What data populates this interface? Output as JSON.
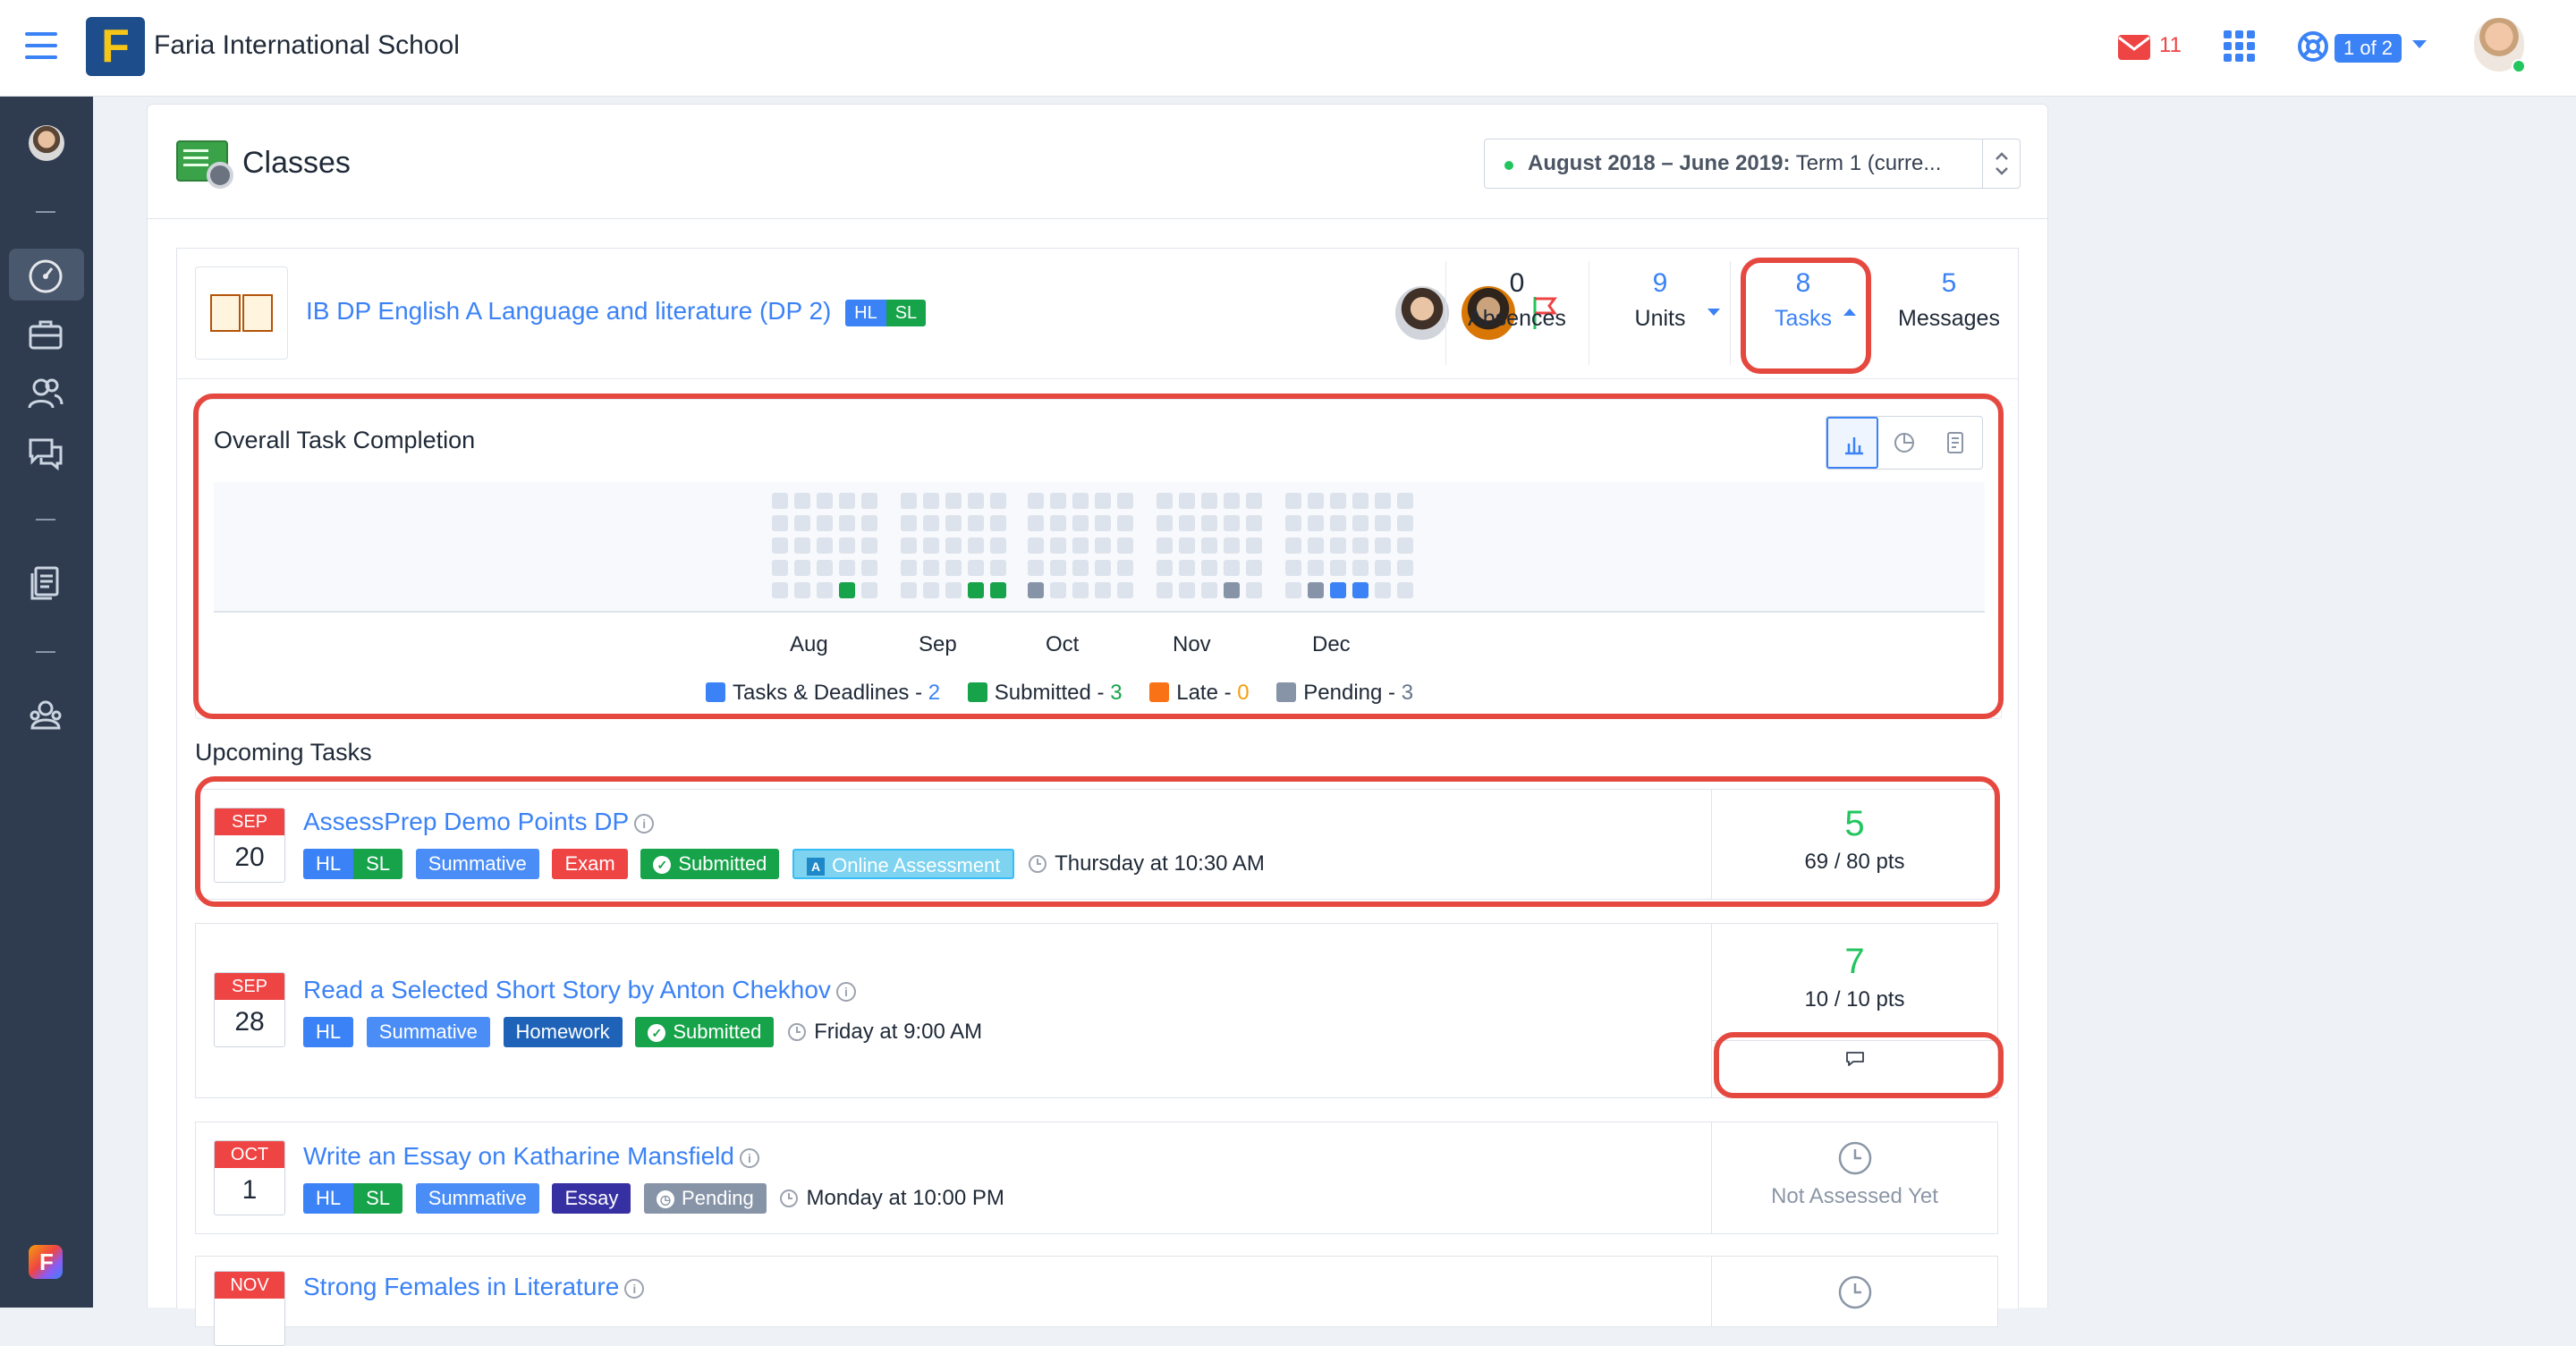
{
  "app": {
    "school_name": "Faria International School",
    "logo_letter": "F",
    "mail_count": "11",
    "pager_label": "1 of 2",
    "accent_color": "#3b82f6"
  },
  "sidebar": {
    "items": [
      {
        "name": "avatar"
      },
      {
        "name": "dashboard-icon",
        "active": true
      },
      {
        "name": "briefcase-icon"
      },
      {
        "name": "users-icon"
      },
      {
        "name": "chat-icon"
      },
      {
        "name": "documents-icon"
      },
      {
        "name": "settings-people-icon"
      }
    ]
  },
  "classes": {
    "title": "Classes",
    "term_bold": "August 2018 – June 2019:",
    "term_rest": " Term 1 (curre..."
  },
  "class": {
    "name": "IB DP English A Language and literature (DP 2)",
    "levels": [
      "HL",
      "SL"
    ],
    "stats": [
      {
        "num": "0",
        "label": "Absences"
      },
      {
        "num": "9",
        "label": "Units"
      },
      {
        "num": "8",
        "label": "Tasks"
      },
      {
        "num": "5",
        "label": "Messages"
      }
    ]
  },
  "completion": {
    "title": "Overall Task Completion",
    "months": [
      "Aug",
      "Sep",
      "Oct",
      "Nov",
      "Dec"
    ],
    "legend": [
      {
        "label": "Tasks & Deadlines",
        "sep": " - ",
        "value": "2",
        "color": "#3b82f6"
      },
      {
        "label": "Submitted",
        "sep": " - ",
        "value": "3",
        "color": "#16a34a"
      },
      {
        "label": "Late",
        "sep": " - ",
        "value": "0",
        "color": "#f59e0b"
      },
      {
        "label": "Pending",
        "sep": " - ",
        "value": "3",
        "color": "#8794a8"
      }
    ]
  },
  "upcoming": {
    "title": "Upcoming Tasks",
    "tasks": [
      {
        "month": "SEP",
        "day": "20",
        "title": "AssessPrep Demo Points DP",
        "tags": [
          "HL",
          "SL",
          "Summative",
          "Exam",
          "Submitted",
          "Online Assessment"
        ],
        "when": "Thursday at 10:30 AM",
        "score": "5",
        "pts": "69 / 80 pts"
      },
      {
        "month": "SEP",
        "day": "28",
        "title": "Read a Selected Short Story by Anton Chekhov",
        "tags": [
          "HL",
          "Summative",
          "Homework",
          "Submitted"
        ],
        "when": "Friday at 9:00 AM",
        "score": "7",
        "pts": "10 / 10 pts"
      },
      {
        "month": "OCT",
        "day": "1",
        "title": "Write an Essay on Katharine Mansfield",
        "tags": [
          "HL",
          "SL",
          "Summative",
          "Essay",
          "Pending"
        ],
        "when": "Monday at 10:00 PM",
        "status": "Not Assessed Yet"
      },
      {
        "month": "NOV",
        "day": "",
        "title": "Strong Females in Literature"
      }
    ]
  }
}
